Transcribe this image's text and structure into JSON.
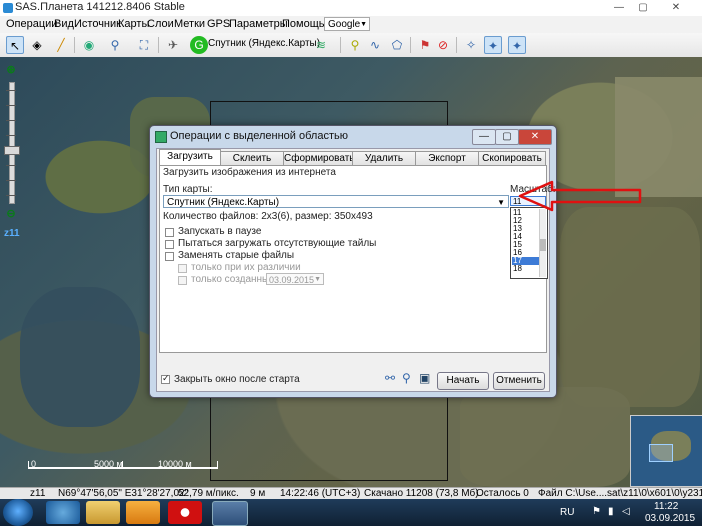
{
  "window": {
    "title": "SAS.Планета 141212.8406 Stable"
  },
  "menu": {
    "items": [
      "Операции",
      "Вид",
      "Источник",
      "Карты",
      "Слои",
      "Метки",
      "GPS",
      "Параметры",
      "Помощь"
    ],
    "google_dropdown": "Google"
  },
  "toolbar": {
    "map_source": "Спутник (Яндекс.Карты)"
  },
  "zoom": {
    "label": "z11"
  },
  "scale": {
    "left_label": "0",
    "mid_label": "5000 м",
    "right_label": "10000 м"
  },
  "status": {
    "zoom": "z11",
    "coords": "N69°47'56,05\" E31°28'27,02\"",
    "resolution": "52,79 м/пикс.",
    "distance": "9 м",
    "time": "14:22:46 (UTC+3)",
    "downloaded": "Скачано 11208 (73,8 Мб)",
    "remaining": "Осталось 0",
    "file": "Файл C:\\Use....sat\\z11\\0\\x601\\0\\y231.jpg"
  },
  "dialog": {
    "title": "Операции с выделенной областью",
    "tabs": [
      "Загрузить",
      "Склеить",
      "Сформировать",
      "Удалить",
      "Экспорт",
      "Скопировать"
    ],
    "active_tab": 0,
    "section_title": "Загрузить изображения из интернета",
    "map_type_label": "Тип карты:",
    "map_type_value": "Спутник (Яндекс.Карты)",
    "scale_label": "Масштаб:",
    "scale_selected": "11",
    "scale_options": [
      "11",
      "12",
      "13",
      "14",
      "15",
      "16",
      "17",
      "18"
    ],
    "scale_highlight": "17",
    "files_info": "Количество файлов: 2x3(6), размер: 350x493",
    "options": {
      "pause": "Запускать в паузе",
      "missing": "Пытаться загружать отсутствующие тайлы",
      "replace_old": "Заменять старые файлы",
      "only_diff": "только при их различии",
      "only_created": "только созданные до",
      "date": "03.09.2015"
    },
    "close_after": "Закрыть окно после старта",
    "start_button": "Начать",
    "cancel_button": "Отменить"
  },
  "taskbar": {
    "lang": "RU",
    "time": "11:22",
    "date": "03.09.2015"
  }
}
